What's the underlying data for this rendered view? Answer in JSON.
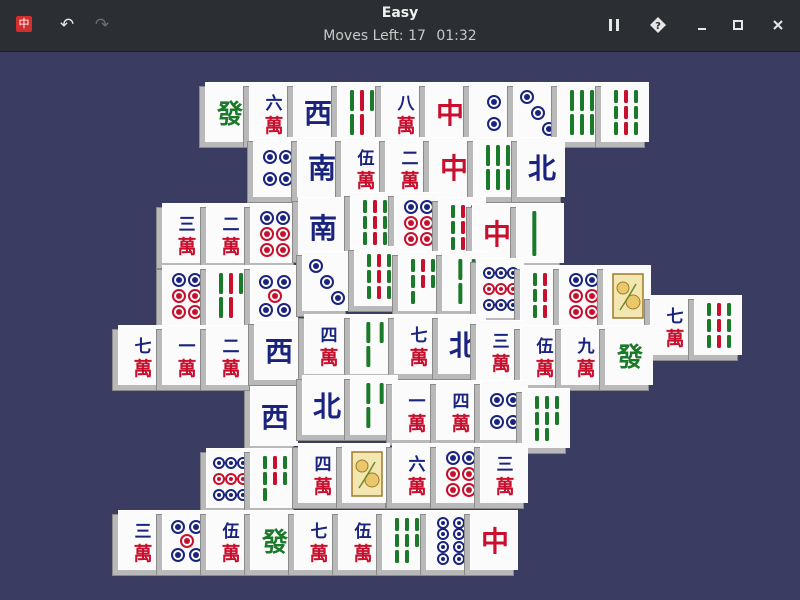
{
  "app": {
    "icon": "mahjong-app-icon",
    "title": "Easy",
    "moves_left": "Moves Left: 17",
    "timer": "01:32"
  },
  "toolbar": {
    "undo_icon": "undo-icon",
    "redo_icon": "redo-icon",
    "pause_icon": "pause-icon",
    "hint_icon": "hint-icon",
    "minimize_icon": "minimize-icon",
    "maximize_icon": "maximize-icon",
    "close_icon": "close-icon"
  },
  "colors": {
    "background": "#3a3c62",
    "titlebar": "#2b2e33",
    "tile_face": "#fbfbfb",
    "red": "#c8102e",
    "blue": "#1a237e",
    "green": "#1b7a2a"
  },
  "tiles": [
    {
      "face": "F"
    },
    {
      "face": "C6"
    },
    {
      "face": "W"
    },
    {
      "face": "B5"
    },
    {
      "face": "C8"
    },
    {
      "face": "R"
    },
    {
      "face": "D2"
    },
    {
      "face": "D3"
    },
    {
      "face": "B6"
    },
    {
      "face": "B9"
    },
    {
      "face": "D4"
    },
    {
      "face": "S"
    },
    {
      "face": "C5"
    },
    {
      "face": "C2"
    },
    {
      "face": "R"
    },
    {
      "face": "B6"
    },
    {
      "face": "N"
    },
    {
      "face": "C3"
    },
    {
      "face": "C2"
    },
    {
      "face": "D6"
    },
    {
      "face": "S"
    },
    {
      "face": "B9"
    },
    {
      "face": "D6"
    },
    {
      "face": "B9"
    },
    {
      "face": "R"
    },
    {
      "face": "B1"
    },
    {
      "face": "D6"
    },
    {
      "face": "B5"
    },
    {
      "face": "D5"
    },
    {
      "face": "D3"
    },
    {
      "face": "B9"
    },
    {
      "face": "B7"
    },
    {
      "face": "B4"
    },
    {
      "face": "D9"
    },
    {
      "face": "B9"
    },
    {
      "face": "D6"
    },
    {
      "face": "FL"
    },
    {
      "face": "C7"
    },
    {
      "face": "B9"
    },
    {
      "face": "C7"
    },
    {
      "face": "C1"
    },
    {
      "face": "C2"
    },
    {
      "face": "W"
    },
    {
      "face": "C4"
    },
    {
      "face": "B3"
    },
    {
      "face": "C7"
    },
    {
      "face": "N"
    },
    {
      "face": "C3"
    },
    {
      "face": "C5"
    },
    {
      "face": "C9"
    },
    {
      "face": "F"
    },
    {
      "face": "W"
    },
    {
      "face": "N"
    },
    {
      "face": "B3"
    },
    {
      "face": "C1"
    },
    {
      "face": "C4"
    },
    {
      "face": "D4"
    },
    {
      "face": "B8"
    },
    {
      "face": "D9"
    },
    {
      "face": "B7"
    },
    {
      "face": "C4"
    },
    {
      "face": "FL"
    },
    {
      "face": "C6"
    },
    {
      "face": "D6"
    },
    {
      "face": "C3"
    },
    {
      "face": "C3"
    },
    {
      "face": "D5"
    },
    {
      "face": "C5"
    },
    {
      "face": "F"
    },
    {
      "face": "C7"
    },
    {
      "face": "C5"
    },
    {
      "face": "B8"
    },
    {
      "face": "D8"
    },
    {
      "face": "R"
    }
  ]
}
